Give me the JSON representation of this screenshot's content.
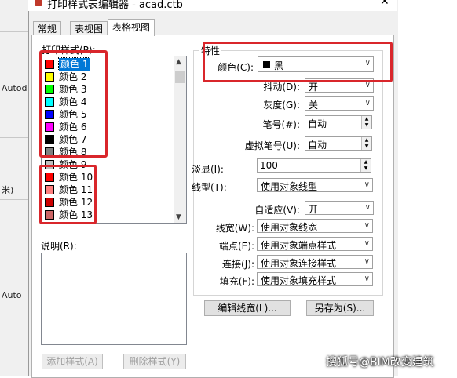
{
  "window": {
    "title": "打印样式表编辑器 - acad.ctb"
  },
  "background": {
    "left_texts": [
      "Autod",
      "米)",
      "Auto"
    ]
  },
  "tabs": [
    {
      "label": "常规"
    },
    {
      "label": "表视图"
    },
    {
      "label": "表格视图"
    }
  ],
  "styles": {
    "label": "打印样式(P):",
    "items": [
      {
        "label": "颜色 1",
        "color": "#ff0000",
        "selected": true
      },
      {
        "label": "颜色 2",
        "color": "#ffff00"
      },
      {
        "label": "颜色 3",
        "color": "#00ff00"
      },
      {
        "label": "颜色 4",
        "color": "#00ffff"
      },
      {
        "label": "颜色 5",
        "color": "#0000ff"
      },
      {
        "label": "颜色 6",
        "color": "#ff00ff"
      },
      {
        "label": "颜色 7",
        "color": "#000000"
      },
      {
        "label": "颜色 8",
        "color": "#808080"
      },
      {
        "label": "颜色 9",
        "color": "#c0c0c0"
      },
      {
        "label": "颜色 10",
        "color": "#ff0000"
      },
      {
        "label": "颜色 11",
        "color": "#ff7f7f"
      },
      {
        "label": "颜色 12",
        "color": "#cc0000"
      },
      {
        "label": "颜色 13",
        "color": "#cc6666"
      }
    ]
  },
  "description": {
    "label": "说明(R):"
  },
  "buttons": {
    "add_style": "添加样式(A)",
    "delete_style": "删除样式(Y)",
    "edit_lineweights": "编辑线宽(L)...",
    "save_as": "另存为(S)..."
  },
  "properties": {
    "title": "特性",
    "color": {
      "label": "颜色(C):",
      "value": "黑",
      "swatch": "#000000"
    },
    "dither": {
      "label": "抖动(D):",
      "value": "开"
    },
    "grayscale": {
      "label": "灰度(G):",
      "value": "关"
    },
    "pen": {
      "label": "笔号(#):",
      "value": "自动"
    },
    "virtual_pen": {
      "label": "虚拟笔号(U):",
      "value": "自动"
    },
    "screening": {
      "label": "淡显(I):",
      "value": "100"
    },
    "linetype": {
      "label": "线型(T):",
      "value": "使用对象线型"
    },
    "adaptive": {
      "label": "自适应(V):",
      "value": "开"
    },
    "lineweight": {
      "label": "线宽(W):",
      "value": "使用对象线宽"
    },
    "line_end": {
      "label": "端点(E):",
      "value": "使用对象端点样式"
    },
    "line_join": {
      "label": "连接(J):",
      "value": "使用对象连接样式"
    },
    "fill": {
      "label": "填充(F):",
      "value": "使用对象填充样式"
    }
  },
  "watermark": "搜狐号@BIM改变建筑",
  "accent_colors": {
    "highlight": "#d9262b",
    "selection": "#0078d7"
  }
}
